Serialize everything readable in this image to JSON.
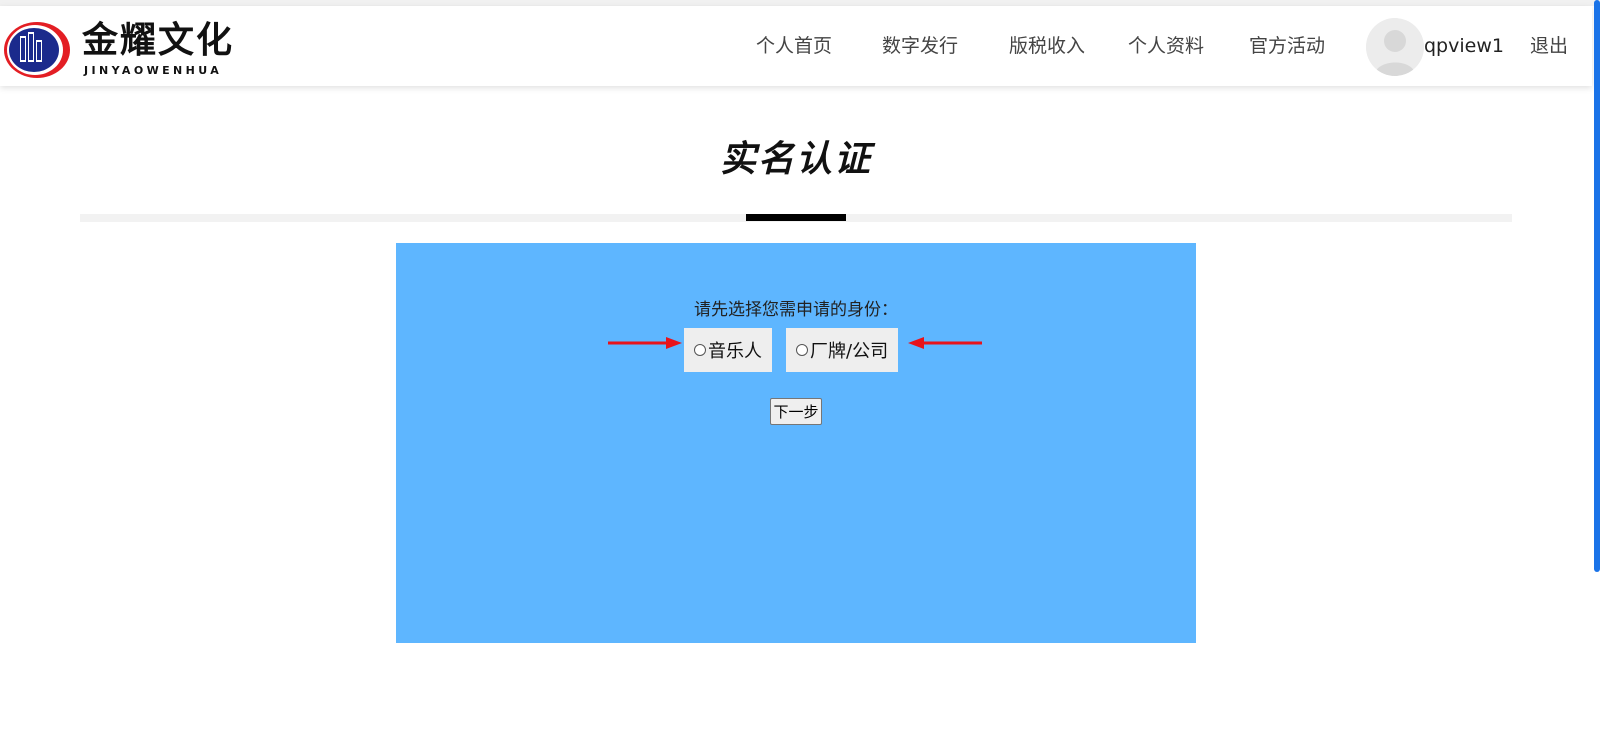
{
  "header": {
    "logo_title": "金耀文化",
    "logo_subtitle": "JINYAOWENHUA",
    "nav": [
      {
        "label": "个人首页"
      },
      {
        "label": "数字发行"
      },
      {
        "label": "版税收入"
      },
      {
        "label": "个人资料"
      },
      {
        "label": "官方活动"
      }
    ],
    "username": "qpview1",
    "logout": "退出"
  },
  "page": {
    "title": "实名认证"
  },
  "form": {
    "prompt": "请先选择您需申请的身份：",
    "options": [
      {
        "label": "音乐人",
        "selected": false
      },
      {
        "label": "厂牌/公司",
        "selected": false
      }
    ],
    "next_label": "下一步"
  },
  "colors": {
    "panel_bg": "#5eb6ff",
    "annotation_arrow": "#e8131b",
    "accent": "#1a73e8"
  }
}
